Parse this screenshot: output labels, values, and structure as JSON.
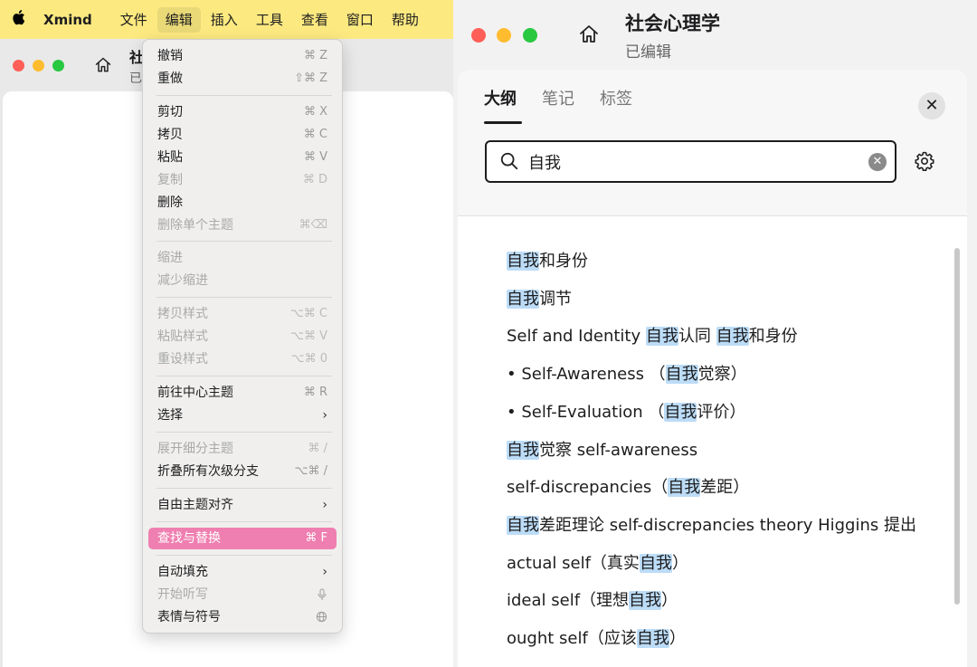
{
  "menubar": {
    "app_name": "Xmind",
    "items": [
      "文件",
      "编辑",
      "插入",
      "工具",
      "查看",
      "窗口",
      "帮助"
    ]
  },
  "left_window": {
    "title": "社",
    "subtitle": "已"
  },
  "edit_menu": {
    "items": [
      {
        "label": "撤销",
        "shortcut": "⌘ Z",
        "disabled": false
      },
      {
        "label": "重做",
        "shortcut": "⇧⌘ Z",
        "disabled": false
      },
      {
        "label": "剪切",
        "shortcut": "⌘ X",
        "disabled": false
      },
      {
        "label": "拷贝",
        "shortcut": "⌘ C",
        "disabled": false
      },
      {
        "label": "粘贴",
        "shortcut": "⌘ V",
        "disabled": false
      },
      {
        "label": "复制",
        "shortcut": "⌘ D",
        "disabled": true
      },
      {
        "label": "删除",
        "shortcut": "",
        "disabled": false
      },
      {
        "label": "删除单个主题",
        "shortcut": "⌘⌫",
        "disabled": true
      },
      {
        "label": "缩进",
        "shortcut": "",
        "disabled": true
      },
      {
        "label": "减少缩进",
        "shortcut": "",
        "disabled": true
      },
      {
        "label": "拷贝样式",
        "shortcut": "⌥⌘ C",
        "disabled": true
      },
      {
        "label": "粘贴样式",
        "shortcut": "⌥⌘ V",
        "disabled": true
      },
      {
        "label": "重设样式",
        "shortcut": "⌥⌘ 0",
        "disabled": true
      },
      {
        "label": "前往中心主题",
        "shortcut": "⌘ R",
        "disabled": false
      },
      {
        "label": "选择",
        "shortcut": "",
        "submenu": true,
        "disabled": false
      },
      {
        "label": "展开细分主题",
        "shortcut": "⌘ /",
        "disabled": true
      },
      {
        "label": "折叠所有次级分支",
        "shortcut": "⌥⌘ /",
        "disabled": false
      },
      {
        "label": "自由主题对齐",
        "shortcut": "",
        "submenu": true,
        "disabled": false
      },
      {
        "label": "查找与替换",
        "shortcut": "⌘ F",
        "disabled": false,
        "highlighted": true
      },
      {
        "label": "自动填充",
        "shortcut": "",
        "submenu": true,
        "disabled": false
      },
      {
        "label": "开始听写",
        "shortcut": "mic",
        "disabled": true
      },
      {
        "label": "表情与符号",
        "shortcut": "globe",
        "disabled": false
      }
    ]
  },
  "right_window": {
    "title": "社会心理学",
    "subtitle": "已编辑",
    "tabs": [
      "大纲",
      "笔记",
      "标签"
    ],
    "active_tab": "大纲",
    "search": {
      "value": "自我",
      "placeholder": ""
    },
    "results": [
      [
        {
          "t": "自我",
          "m": true
        },
        {
          "t": "和身份",
          "m": false
        }
      ],
      [
        {
          "t": "自我",
          "m": true
        },
        {
          "t": "调节",
          "m": false
        }
      ],
      [
        {
          "t": "Self and Identity ",
          "m": false
        },
        {
          "t": "自我",
          "m": true
        },
        {
          "t": "认同 ",
          "m": false
        },
        {
          "t": "自我",
          "m": true
        },
        {
          "t": "和身份",
          "m": false
        }
      ],
      [
        {
          "t": "• Self-Awareness （",
          "m": false
        },
        {
          "t": "自我",
          "m": true
        },
        {
          "t": "觉察）",
          "m": false
        }
      ],
      [
        {
          "t": "• Self-Evaluation （",
          "m": false
        },
        {
          "t": "自我",
          "m": true
        },
        {
          "t": "评价）",
          "m": false
        }
      ],
      [
        {
          "t": "自我",
          "m": true
        },
        {
          "t": "觉察 self-awareness",
          "m": false
        }
      ],
      [
        {
          "t": "self-discrepancies（",
          "m": false
        },
        {
          "t": "自我",
          "m": true
        },
        {
          "t": "差距）",
          "m": false
        }
      ],
      [
        {
          "t": "自我",
          "m": true
        },
        {
          "t": "差距理论 self-discrepancies theory Higgins 提出",
          "m": false
        }
      ],
      [
        {
          "t": "actual self（真实",
          "m": false
        },
        {
          "t": "自我",
          "m": true
        },
        {
          "t": "）",
          "m": false
        }
      ],
      [
        {
          "t": "ideal self（理想",
          "m": false
        },
        {
          "t": "自我",
          "m": true
        },
        {
          "t": "）",
          "m": false
        }
      ],
      [
        {
          "t": "ought self（应该",
          "m": false
        },
        {
          "t": "自我",
          "m": true
        },
        {
          "t": "）",
          "m": false
        }
      ]
    ]
  },
  "colors": {
    "menubar_bg": "#fce980",
    "highlight": "#ef7fb0",
    "search_mark": "#bcdcf7",
    "traffic_red": "#ff5f57",
    "traffic_yellow": "#febc2e",
    "traffic_green": "#28c840"
  }
}
